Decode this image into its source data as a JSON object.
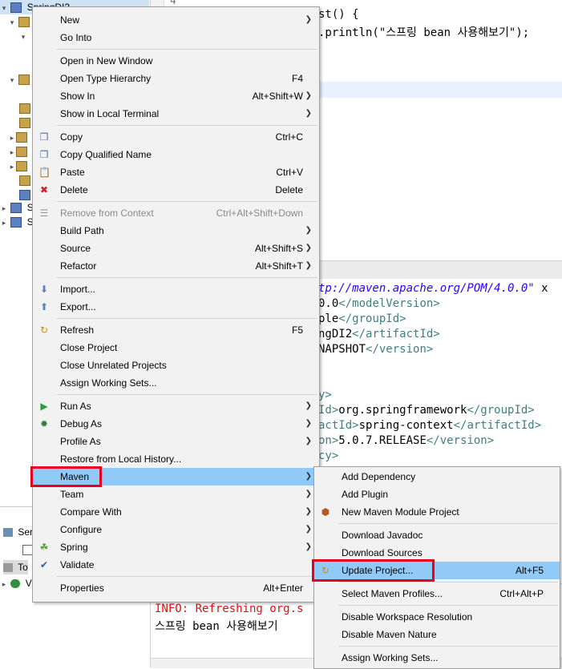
{
  "explorer": {
    "project_label": "SpringDI2",
    "bottom_items": [
      "Sp",
      "Sp"
    ],
    "lower_tabs": [
      "Ser...",
      "To",
      "VI"
    ]
  },
  "editor": {
    "gutter_number": "4",
    "code_lines": [
      "st() {",
      ".println(\"스프링 bean 사용해보기\");"
    ]
  },
  "xml": {
    "lines": [
      {
        "pre": "tp://maven.apache.org/POM/4.0.0\"",
        "post": " x"
      },
      {
        "a": "0.0",
        "t": "</modelVersion>"
      },
      {
        "a": "ple",
        "t": "</groupId>"
      },
      {
        "a": "ngDI2",
        "t": "</artifactId>"
      },
      {
        "a": "NAPSHOT",
        "t": "</version>"
      },
      {
        "a": "",
        "t": ""
      },
      {
        "a": "",
        "t": "y>"
      },
      {
        "tag": "Id>",
        "a": "org.springframework",
        "t": "</groupId>"
      },
      {
        "tag": "actId>",
        "a": "spring-context",
        "t": "</artifactId>"
      },
      {
        "tag": "on>",
        "a": "5.0.7.RELEASE",
        "t": "</version>"
      },
      {
        "a": "",
        "t": "cy>"
      }
    ]
  },
  "console": {
    "info_line": "INFO: Refreshing org.s",
    "out_line": "스프링 bean 사용해보기"
  },
  "context_menu": {
    "items": [
      {
        "label": "New",
        "arrow": true
      },
      {
        "label": "Go Into"
      },
      {
        "sep": true
      },
      {
        "label": "Open in New Window"
      },
      {
        "label": "Open Type Hierarchy",
        "shortcut": "F4"
      },
      {
        "label": "Show In",
        "shortcut": "Alt+Shift+W",
        "arrow": true
      },
      {
        "label": "Show in Local Terminal",
        "arrow": true
      },
      {
        "sep": true
      },
      {
        "label": "Copy",
        "shortcut": "Ctrl+C",
        "icon": "copy-icon"
      },
      {
        "label": "Copy Qualified Name",
        "icon": "copy-qualified-icon"
      },
      {
        "label": "Paste",
        "shortcut": "Ctrl+V",
        "icon": "paste-icon"
      },
      {
        "label": "Delete",
        "shortcut": "Delete",
        "icon": "delete-icon"
      },
      {
        "sep": true
      },
      {
        "label": "Remove from Context",
        "shortcut": "Ctrl+Alt+Shift+Down",
        "disabled": true,
        "icon": "remove-context-icon"
      },
      {
        "label": "Build Path",
        "arrow": true
      },
      {
        "label": "Source",
        "shortcut": "Alt+Shift+S",
        "arrow": true
      },
      {
        "label": "Refactor",
        "shortcut": "Alt+Shift+T",
        "arrow": true
      },
      {
        "sep": true
      },
      {
        "label": "Import...",
        "icon": "import-icon"
      },
      {
        "label": "Export...",
        "icon": "export-icon"
      },
      {
        "sep": true
      },
      {
        "label": "Refresh",
        "shortcut": "F5",
        "icon": "refresh-icon"
      },
      {
        "label": "Close Project"
      },
      {
        "label": "Close Unrelated Projects"
      },
      {
        "label": "Assign Working Sets..."
      },
      {
        "sep": true
      },
      {
        "label": "Run As",
        "arrow": true,
        "icon": "run-icon"
      },
      {
        "label": "Debug As",
        "arrow": true,
        "icon": "debug-icon"
      },
      {
        "label": "Profile As",
        "arrow": true
      },
      {
        "label": "Restore from Local History..."
      },
      {
        "label": "Maven",
        "arrow": true,
        "highlight": true
      },
      {
        "label": "Team",
        "arrow": true
      },
      {
        "label": "Compare With",
        "arrow": true
      },
      {
        "label": "Configure",
        "arrow": true
      },
      {
        "label": "Spring",
        "arrow": true,
        "icon": "spring-icon"
      },
      {
        "label": "Validate",
        "icon": "check-icon"
      },
      {
        "sep": true
      },
      {
        "label": "Properties",
        "shortcut": "Alt+Enter"
      }
    ]
  },
  "maven_submenu": {
    "items": [
      {
        "label": "Add Dependency"
      },
      {
        "label": "Add Plugin"
      },
      {
        "label": "New Maven Module Project",
        "icon": "maven-module-icon"
      },
      {
        "sep": true
      },
      {
        "label": "Download Javadoc"
      },
      {
        "label": "Download Sources"
      },
      {
        "label": "Update Project...",
        "shortcut": "Alt+F5",
        "highlight": true,
        "icon": "maven-update-icon"
      },
      {
        "sep": true
      },
      {
        "label": "Select Maven Profiles...",
        "shortcut": "Ctrl+Alt+P"
      },
      {
        "sep": true
      },
      {
        "label": "Disable Workspace Resolution"
      },
      {
        "label": "Disable Maven Nature"
      },
      {
        "sep": true
      },
      {
        "label": "Assign Working Sets..."
      }
    ]
  },
  "colors": {
    "highlight": "#91c9f7",
    "annotation_red": "#e8001c",
    "menu_bg": "#f2f2f2"
  }
}
